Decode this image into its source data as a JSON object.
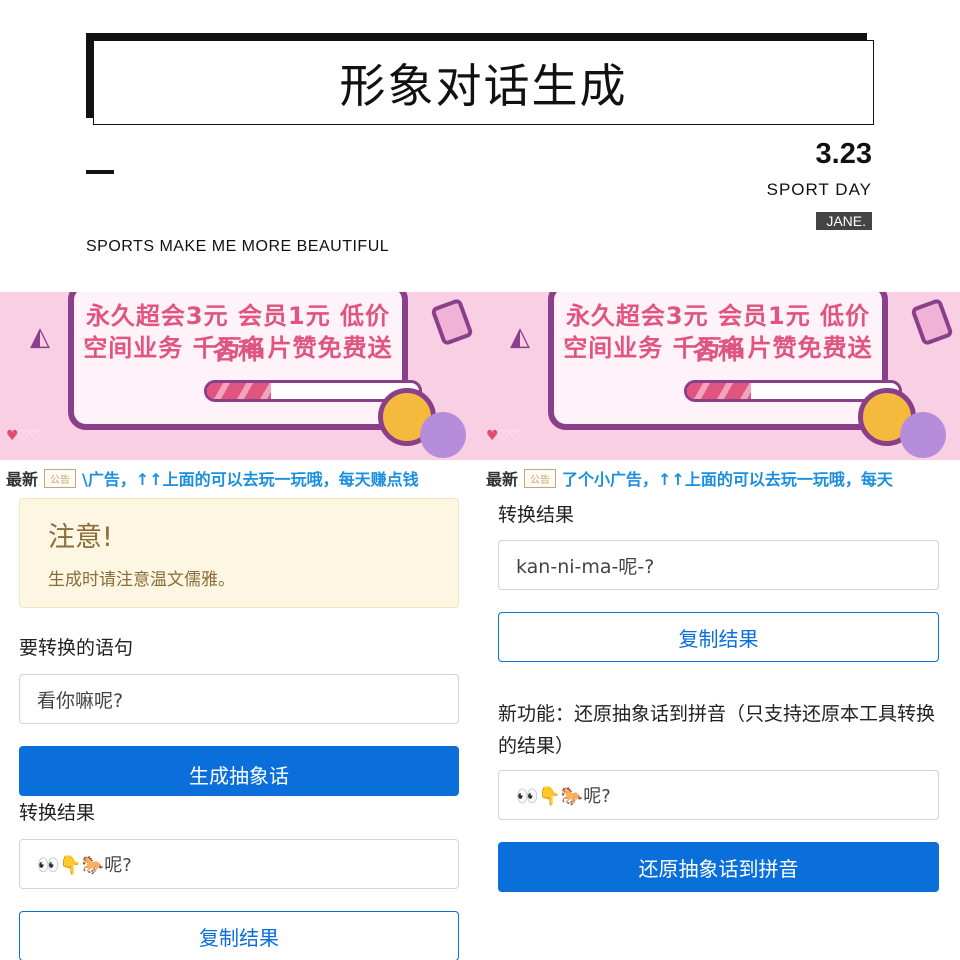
{
  "header": {
    "title": "形象对话生成",
    "date": "3.23",
    "sport_day": "SPORT DAY",
    "author_tag": "JANE.",
    "motto": "SPORTS MAKE ME MORE BEAUTIFUL"
  },
  "banner": {
    "line1": "永久超会3元 会员1元 低价各种",
    "line2": "空间业务 千万名片赞免费送",
    "progress": 0.3,
    "hearts": [
      "♥",
      "♡",
      "♡"
    ]
  },
  "ticker": {
    "latest_label": "最新",
    "badge_label": "公告",
    "left_message": "\\广告，↑↑上面的可以去玩一玩哦，每天赚点钱",
    "right_message": "了个小广告，↑↑上面的可以去玩一玩哦，每天"
  },
  "notice": {
    "title": "注意!",
    "text": "生成时请注意温文儒雅。"
  },
  "left_form": {
    "input_label": "要转换的语句",
    "input_value": "看你嘛呢?",
    "generate_button": "生成抽象话",
    "result_label": "转换结果",
    "result_value": "👀👇🐎呢?",
    "copy_button": "复制结果"
  },
  "right_form": {
    "result_label": "转换结果",
    "result_value": "kan-ni-ma-呢-?",
    "copy_button": "复制结果",
    "feature_label": "新功能：还原抽象话到拼音（只支持还原本工具转换的结果）",
    "feature_input_value": "👀👇🐎呢?",
    "restore_button": "还原抽象话到拼音"
  },
  "colors": {
    "primary": "#0a6fdb",
    "alert_bg": "#fcf6e2",
    "alert_text": "#8c6d3a",
    "ticker_text": "#1a8fe0",
    "banner_bg": "#f8cfe3"
  }
}
